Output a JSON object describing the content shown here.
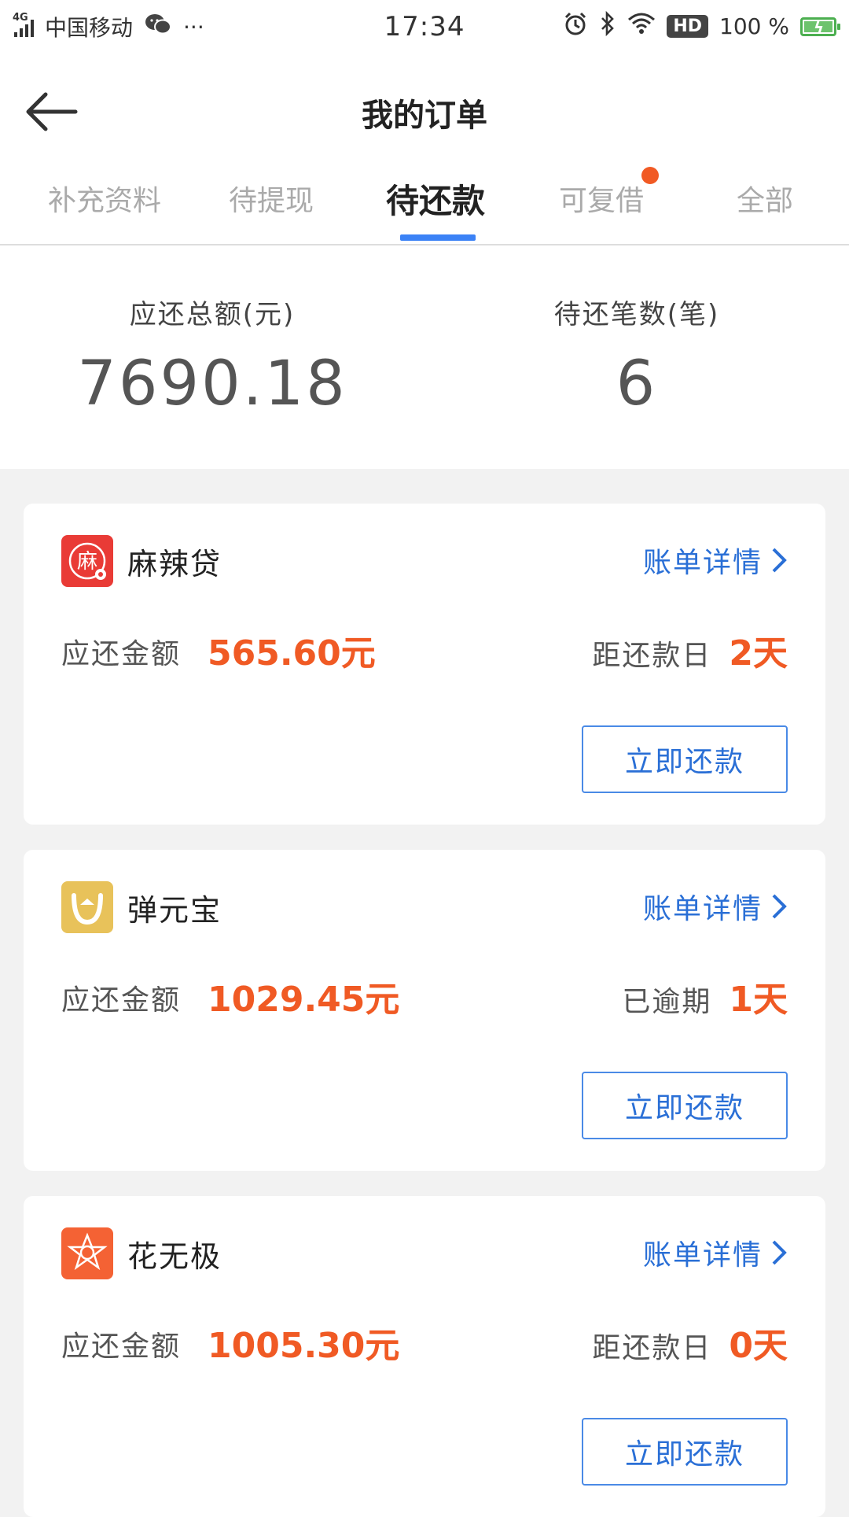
{
  "status_bar": {
    "network": "4G",
    "carrier": "中国移动",
    "more": "···",
    "time": "17:34",
    "hd_label": "HD",
    "battery_text": "100 %"
  },
  "header": {
    "title": "我的订单"
  },
  "tabs": [
    {
      "label": "补充资料",
      "active": false
    },
    {
      "label": "待提现",
      "active": false
    },
    {
      "label": "待还款",
      "active": true
    },
    {
      "label": "可复借",
      "active": false,
      "has_badge": true
    },
    {
      "label": "全部",
      "active": false
    }
  ],
  "summary": {
    "total_label": "应还总额(元)",
    "total_value": "7690.18",
    "count_label": "待还笔数(笔)",
    "count_value": "6"
  },
  "orders": [
    {
      "name": "麻辣贷",
      "logo_char": "麻",
      "detail_link": "账单详情",
      "amount_label": "应还金额",
      "amount": "565.60元",
      "due_label": "距还款日",
      "due_value": "2天",
      "pay_button": "立即还款"
    },
    {
      "name": "弹元宝",
      "detail_link": "账单详情",
      "amount_label": "应还金额",
      "amount": "1029.45元",
      "due_label": "已逾期",
      "due_value": "1天",
      "pay_button": "立即还款"
    },
    {
      "name": "花无极",
      "detail_link": "账单详情",
      "amount_label": "应还金额",
      "amount": "1005.30元",
      "due_label": "距还款日",
      "due_value": "0天",
      "pay_button": "立即还款"
    }
  ],
  "colors": {
    "accent_blue": "#2a6fd6",
    "amount_orange": "#f05a24",
    "tab_underline": "#3b82f6"
  }
}
